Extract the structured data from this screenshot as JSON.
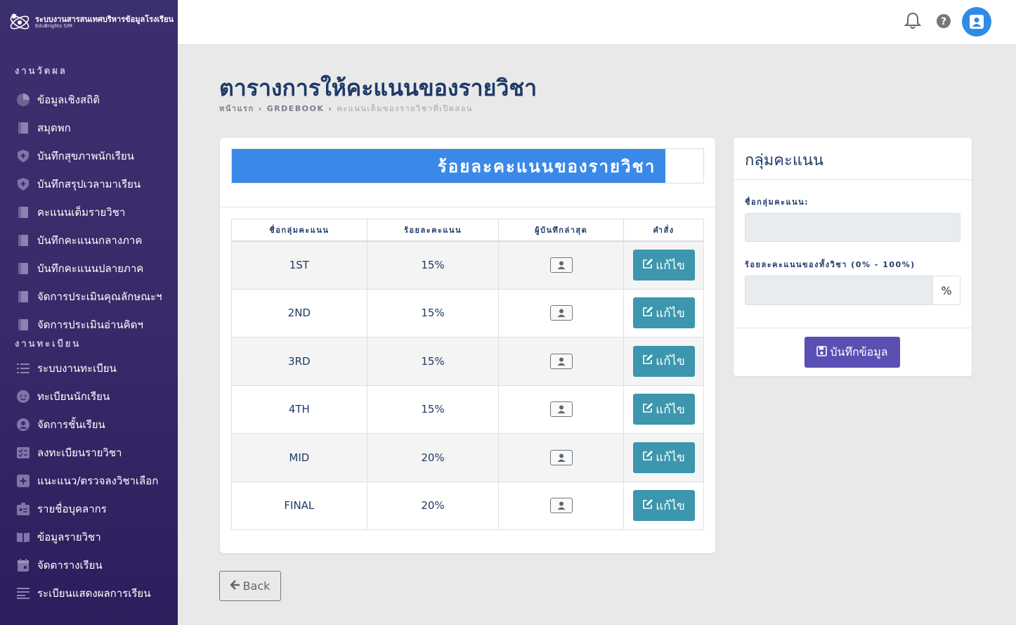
{
  "brand": {
    "title": "ระบบงานสารสนเทศบริหารข้อมูลโรงเรียน",
    "subtitle": "EduBrights SIM"
  },
  "sidebar": {
    "sections": [
      {
        "title": "งานวัดผล",
        "items": [
          {
            "label": "ข้อมูลเชิงสถิติ",
            "icon": "pie-chart-icon"
          },
          {
            "label": "สมุดพก",
            "icon": "book-icon"
          },
          {
            "label": "บันทึกสุขภาพนักเรียน",
            "icon": "shield-icon"
          },
          {
            "label": "บันทึกสรุปเวลามาเรียน",
            "icon": "shield-icon"
          },
          {
            "label": "คะแนนเต็มรายวิชา",
            "icon": "book-icon"
          },
          {
            "label": "บันทึกคะแนนกลางภาค",
            "icon": "book-icon"
          },
          {
            "label": "บันทึกคะแนนปลายภาค",
            "icon": "book-icon"
          },
          {
            "label": "จัดการประเมินคุณลักษณะฯ",
            "icon": "book-icon"
          },
          {
            "label": "จัดการประเมินอ่านคิดฯ",
            "icon": "book-icon"
          }
        ]
      },
      {
        "title": "งานทะเบียน",
        "items": [
          {
            "label": "ระบบงานทะเบียน",
            "icon": "list-icon"
          },
          {
            "label": "ทะเบียนนักเรียน",
            "icon": "face-icon"
          },
          {
            "label": "จัดการชั้นเรียน",
            "icon": "person-circle-icon"
          },
          {
            "label": "ลงทะเบียนรายวิชา",
            "icon": "checklist-icon"
          },
          {
            "label": "แนะแนว/ตรวจลงวิชาเลือก",
            "icon": "sparkle-icon"
          },
          {
            "label": "รายชื่อบุคลากร",
            "icon": "badge-icon"
          },
          {
            "label": "ข้อมูลรายวิชา",
            "icon": "open-book-icon"
          },
          {
            "label": "จัดตารางเรียน",
            "icon": "calendar-icon"
          },
          {
            "label": "ระเบียนแสดงผลการเรียน",
            "icon": "lines-icon"
          }
        ]
      }
    ]
  },
  "page": {
    "title": "ตารางการให้คะแนนของรายวิชา",
    "breadcrumb": [
      "หน้าแรก",
      "GRDEBOOK",
      "คะแนนเต็มของรายวิชาที่เปิดสอน"
    ]
  },
  "progress": {
    "label": "ร้อยละคะแนนของรายวิชา",
    "percent": 92
  },
  "table": {
    "headers": [
      "ชื่อกลุ่มคะแนน",
      "ร้อยละคะแนน",
      "ผู้บันทึกล่าสุด",
      "คำสั่ง"
    ],
    "edit_label": "แก้ไข",
    "rows": [
      {
        "name": "1ST",
        "percent": "15%"
      },
      {
        "name": "2ND",
        "percent": "15%"
      },
      {
        "name": "3RD",
        "percent": "15%"
      },
      {
        "name": "4TH",
        "percent": "15%"
      },
      {
        "name": "MID",
        "percent": "20%"
      },
      {
        "name": "FINAL",
        "percent": "20%"
      }
    ]
  },
  "back_label": "Back",
  "side": {
    "title": "กลุ่มคะแนน",
    "name_label": "ชื่อกลุ่มคะแนน:",
    "percent_label": "ร้อยละคะแนนของทั้งวิชา (0% - 100%)",
    "percent_addon": "%",
    "save_label": "บันทึกข้อมูล"
  },
  "colors": {
    "sidebar": "#3a2a6a",
    "progress": "#3a88e8",
    "edit": "#3b96ae",
    "save": "#5a4fb3",
    "accent_avatar": "#2f8be6"
  }
}
